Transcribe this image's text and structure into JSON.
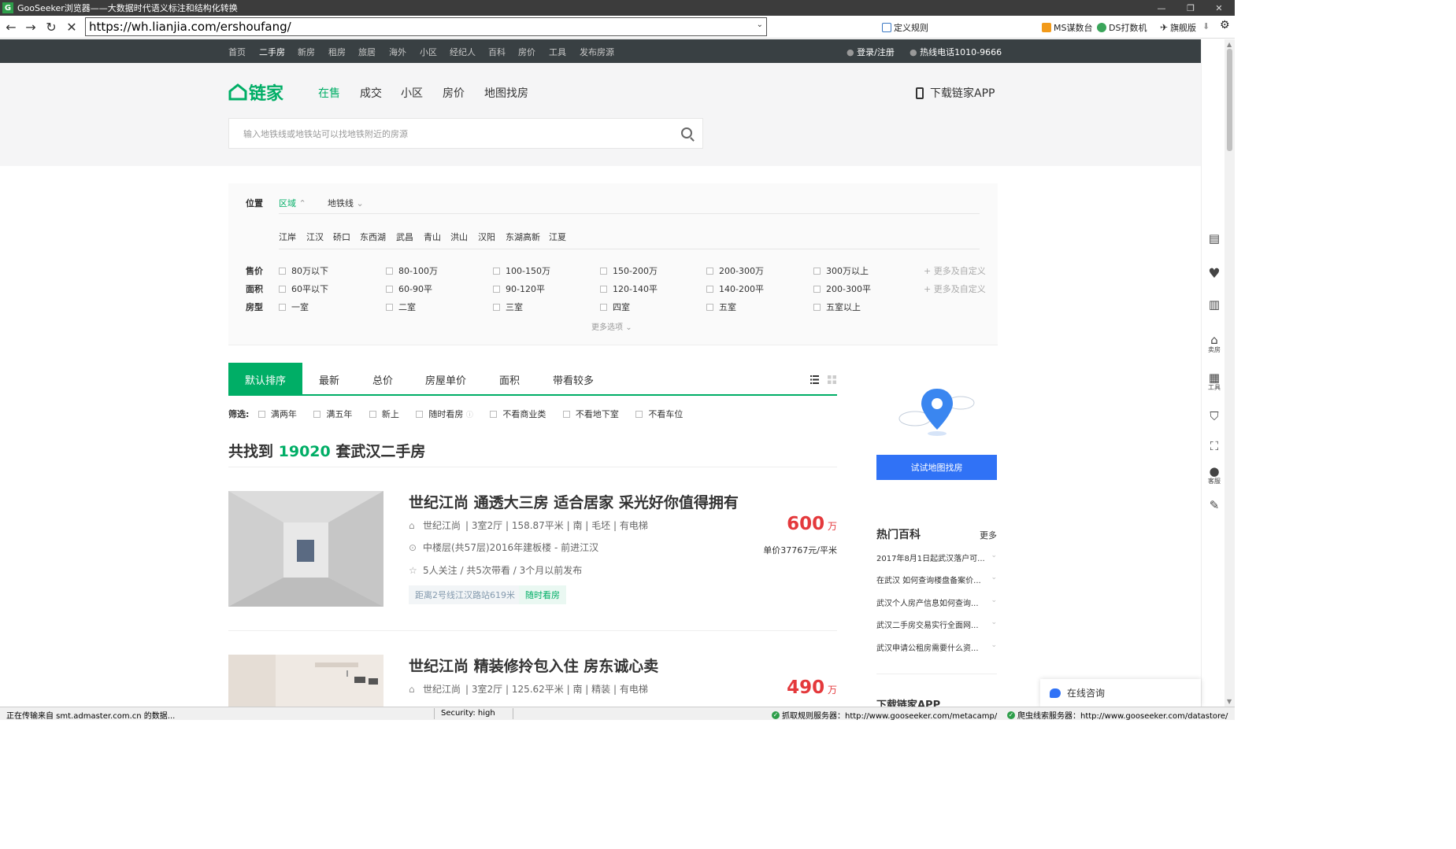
{
  "window": {
    "title": "GooSeeker浏览器——大数据时代语义标注和结构化转换",
    "logo_letter": "G"
  },
  "browser": {
    "url": "https://wh.lianjia.com/ershoufang/",
    "toolbar": {
      "define_rule": "定义规则",
      "ms": "MS谋数台",
      "ds": "DS打数机",
      "flagship": "旗舰版"
    }
  },
  "site_top": {
    "nav": [
      "首页",
      "二手房",
      "新房",
      "租房",
      "旅居",
      "海外",
      "小区",
      "经纪人",
      "百科",
      "房价",
      "工具",
      "发布房源"
    ],
    "active_index": 1,
    "login": "登录/注册",
    "hotline": "热线电话1010-9666"
  },
  "header": {
    "brand": "链家",
    "nav": [
      "在售",
      "成交",
      "小区",
      "房价",
      "地图找房"
    ],
    "active_index": 0,
    "download_app": "下载链家APP",
    "search_placeholder": "输入地铁线或地铁站可以找地铁附近的房源"
  },
  "filters": {
    "location_label": "位置",
    "district_tab": "区域",
    "subway_tab": "地铁线",
    "districts": [
      "江岸",
      "江汉",
      "硚口",
      "东西湖",
      "武昌",
      "青山",
      "洪山",
      "汉阳",
      "东湖高新",
      "江夏"
    ],
    "price_label": "售价",
    "prices": [
      "80万以下",
      "80-100万",
      "100-150万",
      "150-200万",
      "200-300万",
      "300万以上"
    ],
    "area_label": "面积",
    "areas": [
      "60平以下",
      "60-90平",
      "90-120平",
      "120-140平",
      "140-200平",
      "200-300平"
    ],
    "rooms_label": "房型",
    "rooms": [
      "一室",
      "二室",
      "三室",
      "四室",
      "五室",
      "五室以上"
    ],
    "more_custom": "+ 更多及自定义",
    "more_options": "更多选项"
  },
  "sort": {
    "tabs": [
      "默认排序",
      "最新",
      "总价",
      "房屋单价",
      "面积",
      "带看较多"
    ],
    "active_index": 0
  },
  "screen": {
    "label": "筛选:",
    "options": [
      "满两年",
      "满五年",
      "新上",
      "随时看房",
      "不看商业类",
      "不看地下室",
      "不看车位"
    ]
  },
  "result": {
    "prefix": "共找到",
    "count": "19020",
    "suffix": "套武汉二手房"
  },
  "listings": [
    {
      "title": "世纪江尚 通透大三房 适合居家 采光好你值得拥有",
      "community": "世纪江尚",
      "info": "| 3室2厅 | 158.87平米 | 南 | 毛坯 | 有电梯",
      "position": "中楼层(共57层)2016年建板楼 - 前进江汉",
      "follow": "5人关注 / 共5次带看 / 3个月以前发布",
      "tags": [
        "距离2号线江汉路站619米",
        "随时看房"
      ],
      "price": "600",
      "price_unit": "万",
      "unit_price": "单价37767元/平米"
    },
    {
      "title": "世纪江尚 精装修拎包入住 房东诚心卖",
      "community": "世纪江尚",
      "info": "| 3室2厅 | 125.62平米 | 南 | 精装 | 有电梯",
      "price": "490",
      "price_unit": "万"
    }
  ],
  "sidebar": {
    "map_button": "试试地图找房",
    "baike_title": "热门百科",
    "baike_more": "更多",
    "baike_items": [
      "2017年8月1日起武汉落户可...",
      "在武汉 如何查询楼盘备案价...",
      "武汉个人房产信息如何查询...",
      "武汉二手房交易实行全面网...",
      "武汉申请公租房需要什么资..."
    ],
    "download_title": "下载链家APP"
  },
  "right_toolbar": {
    "sell": "卖房",
    "tools": "工具",
    "service": "客服"
  },
  "chat": {
    "label": "在线咨询"
  },
  "status": {
    "left": "正在传输来自 smt.admaster.com.cn 的数据...",
    "security": "Security: high",
    "rule_server": "抓取规则服务器：http://www.gooseeker.com/metacamp/",
    "clue_server": "爬虫线索服务器：http://www.gooseeker.com/datastore/"
  },
  "colors": {
    "brand_green": "#00ae66",
    "price_red": "#e4393c",
    "button_blue": "#3072f6",
    "topbar_dark": "#394043"
  }
}
